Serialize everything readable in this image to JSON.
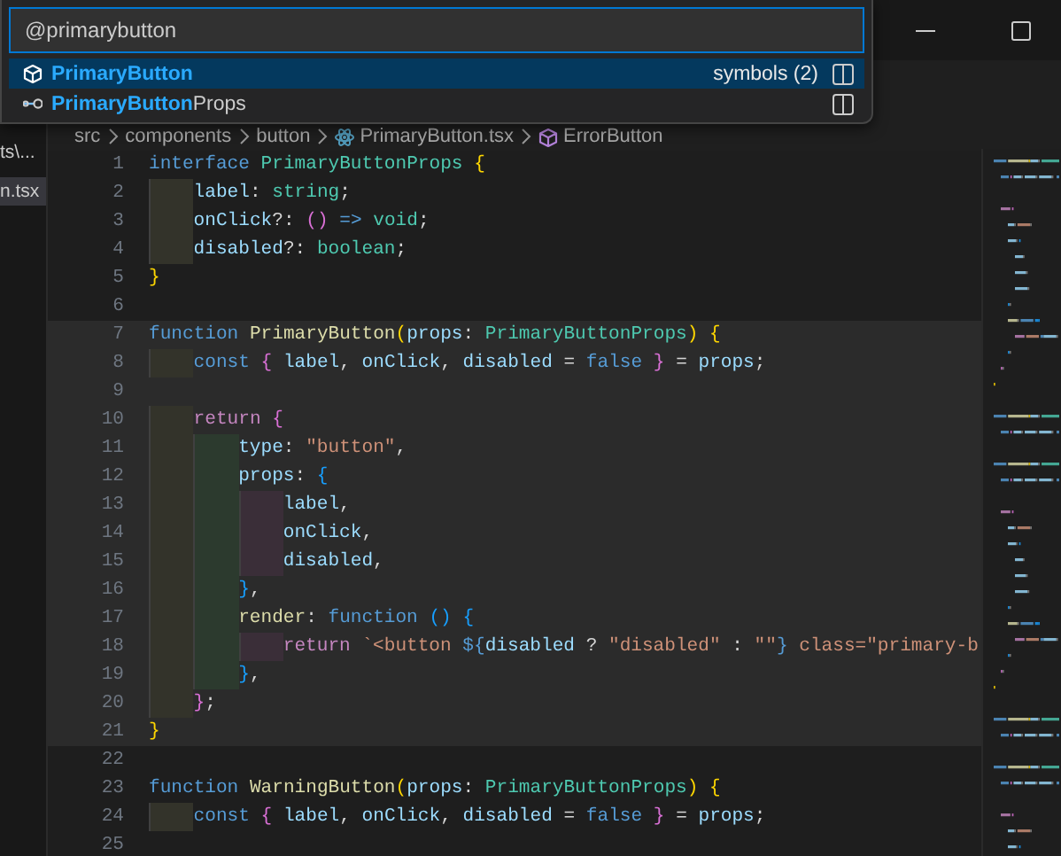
{
  "window": {
    "controls": [
      {
        "kind": "minimize"
      },
      {
        "kind": "maximize"
      }
    ]
  },
  "quick_pick": {
    "value": "@primarybutton",
    "items": [
      {
        "kind": "function",
        "label": "**PrimaryButton**",
        "detail": "symbols (2)",
        "selected": true
      },
      {
        "kind": "interface",
        "label": "**PrimaryButton**Props",
        "selected": false
      }
    ]
  },
  "sidebar": {
    "items": [
      {
        "label": "ts\\...",
        "selected": false
      },
      {
        "label": "n.tsx",
        "selected": true
      }
    ]
  },
  "breadcrumbs": [
    {
      "kind": "folder",
      "label": "src"
    },
    {
      "kind": "folder",
      "label": "components"
    },
    {
      "kind": "folder",
      "label": "button"
    },
    {
      "kind": "react",
      "label": "PrimaryButton.tsx"
    },
    {
      "kind": "symbol",
      "label": "ErrorButton"
    }
  ],
  "editor": {
    "lines": [
      {
        "number": "1",
        "highlighted": false,
        "tokens": [
          {
            "kind": "keyword",
            "text": "interface "
          },
          {
            "kind": "type",
            "text": "PrimaryButtonProps "
          },
          {
            "kind": "bracket1",
            "text": "{"
          }
        ],
        "children": [
          {
            "number": "2",
            "highlighted": false,
            "tokens": [
              {
                "kind": "var",
                "text": "label"
              },
              {
                "kind": "plain",
                "text": ": "
              },
              {
                "kind": "type",
                "text": "string"
              },
              {
                "kind": "plain",
                "text": ";"
              }
            ]
          },
          {
            "number": "3",
            "highlighted": false,
            "tokens": [
              {
                "kind": "var",
                "text": "onClick"
              },
              {
                "kind": "plain",
                "text": "?: "
              },
              {
                "kind": "bracket2",
                "text": "()"
              },
              {
                "kind": "keyword",
                "text": " => "
              },
              {
                "kind": "type",
                "text": "void"
              },
              {
                "kind": "plain",
                "text": ";"
              }
            ]
          },
          {
            "number": "4",
            "highlighted": false,
            "tokens": [
              {
                "kind": "var",
                "text": "disabled"
              },
              {
                "kind": "plain",
                "text": "?: "
              },
              {
                "kind": "type",
                "text": "boolean"
              },
              {
                "kind": "plain",
                "text": ";"
              }
            ]
          }
        ]
      },
      {
        "number": "5",
        "highlighted": false,
        "tokens": [
          {
            "kind": "bracket1",
            "text": "}"
          }
        ]
      },
      {
        "number": "6",
        "highlighted": false
      },
      {
        "number": "7",
        "highlighted": true,
        "tokens": [
          {
            "kind": "keyword",
            "text": "function "
          },
          {
            "kind": "func",
            "text": "PrimaryButton"
          },
          {
            "kind": "bracket1",
            "text": "("
          },
          {
            "kind": "var",
            "text": "props"
          },
          {
            "kind": "plain",
            "text": ": "
          },
          {
            "kind": "type",
            "text": "PrimaryButtonProps"
          },
          {
            "kind": "bracket1",
            "text": ")"
          },
          {
            "kind": "bracket1",
            "text": " {"
          }
        ],
        "children": [
          {
            "number": "8",
            "highlighted": true,
            "tokens": [
              {
                "kind": "keyword",
                "text": "const "
              },
              {
                "kind": "bracket2",
                "text": "{ "
              },
              {
                "kind": "var",
                "text": "label"
              },
              {
                "kind": "plain",
                "text": ", "
              },
              {
                "kind": "var",
                "text": "onClick"
              },
              {
                "kind": "plain",
                "text": ", "
              },
              {
                "kind": "var",
                "text": "disabled"
              },
              {
                "kind": "plain",
                "text": " = "
              },
              {
                "kind": "keyword",
                "text": "false"
              },
              {
                "kind": "bracket2",
                "text": " }"
              },
              {
                "kind": "plain",
                "text": " = "
              },
              {
                "kind": "var",
                "text": "props"
              },
              {
                "kind": "plain",
                "text": ";"
              }
            ]
          },
          {
            "number": "9",
            "highlighted": true
          },
          {
            "number": "10",
            "highlighted": true,
            "tokens": [
              {
                "kind": "control",
                "text": "return "
              },
              {
                "kind": "bracket2",
                "text": "{"
              }
            ],
            "children": [
              {
                "number": "11",
                "highlighted": true,
                "tokens": [
                  {
                    "kind": "var",
                    "text": "type"
                  },
                  {
                    "kind": "plain",
                    "text": ": "
                  },
                  {
                    "kind": "string",
                    "text": "\"button\""
                  },
                  {
                    "kind": "plain",
                    "text": ","
                  }
                ]
              },
              {
                "number": "12",
                "highlighted": true,
                "tokens": [
                  {
                    "kind": "var",
                    "text": "props"
                  },
                  {
                    "kind": "plain",
                    "text": ": "
                  },
                  {
                    "kind": "bracket3",
                    "text": "{"
                  }
                ],
                "children": [
                  {
                    "number": "13",
                    "highlighted": true,
                    "tokens": [
                      {
                        "kind": "var",
                        "text": "label"
                      },
                      {
                        "kind": "plain",
                        "text": ","
                      }
                    ]
                  },
                  {
                    "number": "14",
                    "highlighted": true,
                    "tokens": [
                      {
                        "kind": "var",
                        "text": "onClick"
                      },
                      {
                        "kind": "plain",
                        "text": ","
                      }
                    ]
                  },
                  {
                    "number": "15",
                    "highlighted": true,
                    "tokens": [
                      {
                        "kind": "var",
                        "text": "disabled"
                      },
                      {
                        "kind": "plain",
                        "text": ","
                      }
                    ]
                  }
                ]
              },
              {
                "number": "16",
                "highlighted": true,
                "tokens": [
                  {
                    "kind": "bracket3",
                    "text": "}"
                  },
                  {
                    "kind": "plain",
                    "text": ","
                  }
                ]
              },
              {
                "number": "17",
                "highlighted": true,
                "tokens": [
                  {
                    "kind": "func",
                    "text": "render"
                  },
                  {
                    "kind": "plain",
                    "text": ": "
                  },
                  {
                    "kind": "keyword",
                    "text": "function "
                  },
                  {
                    "kind": "bracket3",
                    "text": "()"
                  },
                  {
                    "kind": "bracket3",
                    "text": " {"
                  }
                ],
                "children": [
                  {
                    "number": "18",
                    "highlighted": true,
                    "tokens": [
                      {
                        "kind": "control",
                        "text": "return "
                      },
                      {
                        "kind": "string",
                        "text": "`<button "
                      },
                      {
                        "kind": "keyword",
                        "text": "${"
                      },
                      {
                        "kind": "var",
                        "text": "disabled"
                      },
                      {
                        "kind": "plain",
                        "text": " ? "
                      },
                      {
                        "kind": "string",
                        "text": "\"disabled\""
                      },
                      {
                        "kind": "plain",
                        "text": " : "
                      },
                      {
                        "kind": "string",
                        "text": "\"\""
                      },
                      {
                        "kind": "keyword",
                        "text": "}"
                      },
                      {
                        "kind": "string",
                        "text": " class=\"primary-b"
                      }
                    ]
                  }
                ]
              },
              {
                "number": "19",
                "highlighted": true,
                "tokens": [
                  {
                    "kind": "bracket3",
                    "text": "}"
                  },
                  {
                    "kind": "plain",
                    "text": ","
                  }
                ]
              }
            ]
          },
          {
            "number": "20",
            "highlighted": true,
            "tokens": [
              {
                "kind": "bracket2",
                "text": "}"
              },
              {
                "kind": "plain",
                "text": ";"
              }
            ]
          }
        ]
      },
      {
        "number": "21",
        "highlighted": true,
        "tokens": [
          {
            "kind": "bracket1",
            "text": "}"
          }
        ]
      },
      {
        "number": "22",
        "highlighted": false
      },
      {
        "number": "23",
        "highlighted": false,
        "tokens": [
          {
            "kind": "keyword",
            "text": "function "
          },
          {
            "kind": "func",
            "text": "WarningButton"
          },
          {
            "kind": "bracket1",
            "text": "("
          },
          {
            "kind": "var",
            "text": "props"
          },
          {
            "kind": "plain",
            "text": ": "
          },
          {
            "kind": "type",
            "text": "PrimaryButtonProps"
          },
          {
            "kind": "bracket1",
            "text": ")"
          },
          {
            "kind": "bracket1",
            "text": " {"
          }
        ],
        "children": [
          {
            "number": "24",
            "highlighted": false,
            "tokens": [
              {
                "kind": "keyword",
                "text": "const "
              },
              {
                "kind": "bracket2",
                "text": "{ "
              },
              {
                "kind": "var",
                "text": "label"
              },
              {
                "kind": "plain",
                "text": ", "
              },
              {
                "kind": "var",
                "text": "onClick"
              },
              {
                "kind": "plain",
                "text": ", "
              },
              {
                "kind": "var",
                "text": "disabled"
              },
              {
                "kind": "plain",
                "text": " = "
              },
              {
                "kind": "keyword",
                "text": "false"
              },
              {
                "kind": "bracket2",
                "text": " }"
              },
              {
                "kind": "plain",
                "text": " = "
              },
              {
                "kind": "var",
                "text": "props"
              },
              {
                "kind": "plain",
                "text": ";"
              }
            ]
          },
          {
            "number": "25",
            "highlighted": false
          }
        ]
      }
    ]
  }
}
